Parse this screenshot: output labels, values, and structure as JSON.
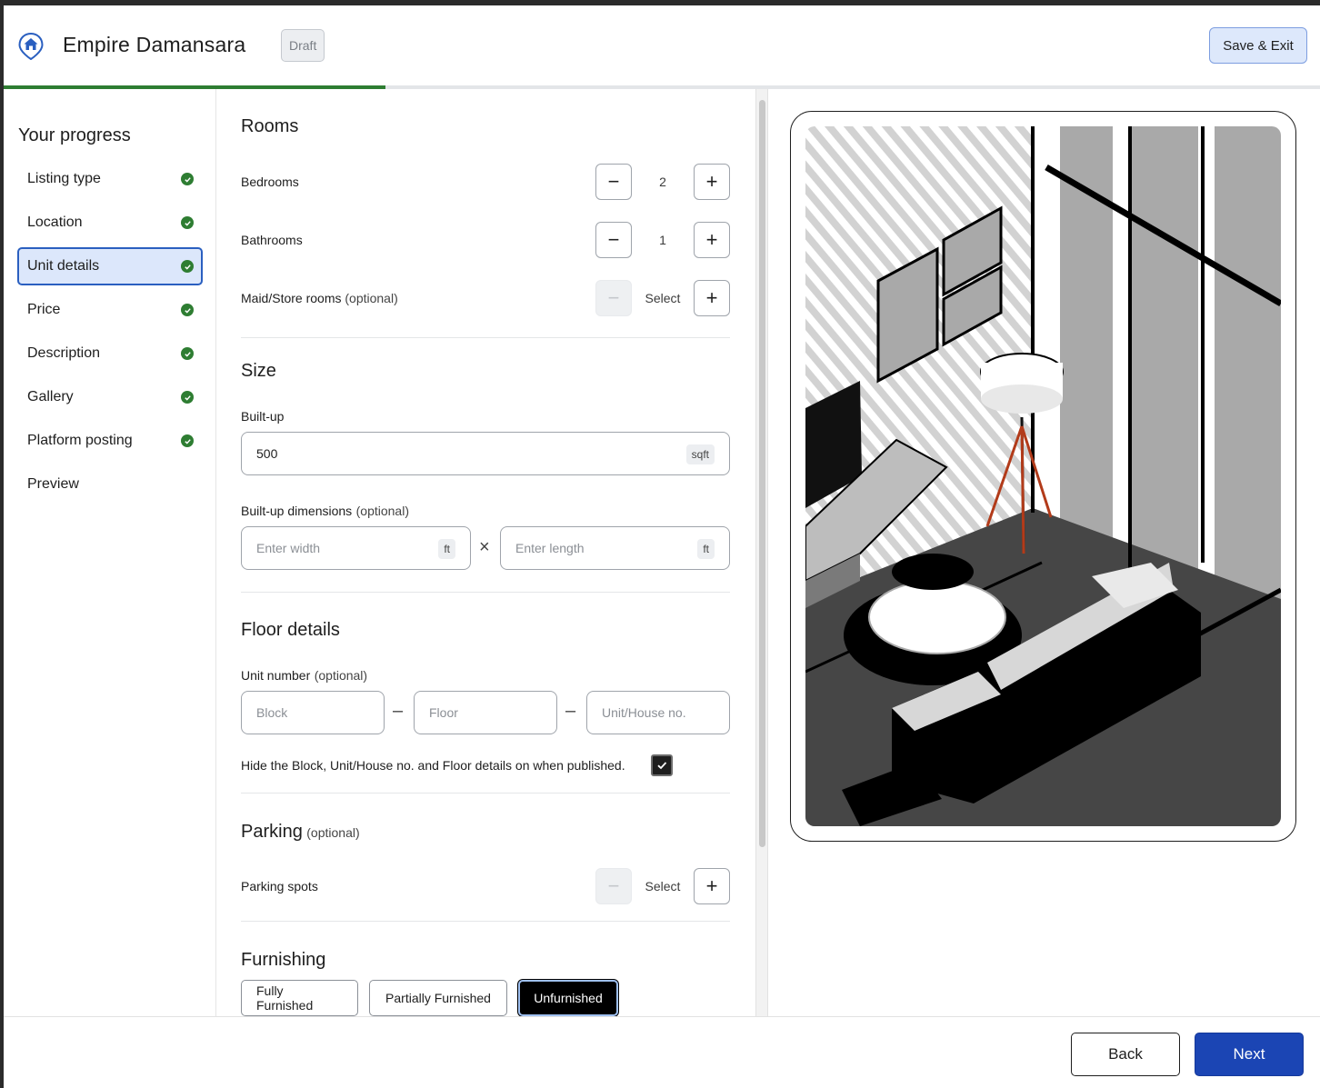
{
  "header": {
    "title": "Empire Damansara",
    "badge": "Draft",
    "save_exit_label": "Save & Exit",
    "progress_fraction": 0.29
  },
  "sidebar": {
    "heading": "Your progress",
    "items": [
      {
        "label": "Listing type",
        "complete": true,
        "active": false
      },
      {
        "label": "Location",
        "complete": true,
        "active": false
      },
      {
        "label": "Unit details",
        "complete": true,
        "active": true
      },
      {
        "label": "Price",
        "complete": true,
        "active": false
      },
      {
        "label": "Description",
        "complete": true,
        "active": false
      },
      {
        "label": "Gallery",
        "complete": true,
        "active": false
      },
      {
        "label": "Platform posting",
        "complete": true,
        "active": false
      },
      {
        "label": "Preview",
        "complete": false,
        "active": false
      }
    ]
  },
  "rooms": {
    "heading": "Rooms",
    "bedrooms": {
      "label": "Bedrooms",
      "value": "2"
    },
    "bathrooms": {
      "label": "Bathrooms",
      "value": "1"
    },
    "maid": {
      "label": "Maid/Store rooms",
      "optional": "(optional)",
      "value": "Select"
    }
  },
  "size": {
    "heading": "Size",
    "builtup_label": "Built-up",
    "builtup_value": "500",
    "builtup_unit": "sqft",
    "dims_label": "Built-up dimensions",
    "dims_optional": "(optional)",
    "width_placeholder": "Enter width",
    "length_placeholder": "Enter length",
    "dim_unit": "ft",
    "times": "×"
  },
  "floor": {
    "heading": "Floor details",
    "unit_label": "Unit number",
    "unit_optional": "(optional)",
    "block_placeholder": "Block",
    "floor_placeholder": "Floor",
    "unitno_placeholder": "Unit/House no.",
    "dash": "–",
    "hide_label": "Hide the Block, Unit/House no. and Floor details on when published.",
    "hide_checked": true
  },
  "parking": {
    "heading": "Parking",
    "optional": "(optional)",
    "spots_label": "Parking spots",
    "spots_value": "Select"
  },
  "furnishing": {
    "heading": "Furnishing",
    "options": [
      "Fully Furnished",
      "Partially Furnished",
      "Unfurnished"
    ],
    "selected": "Unfurnished"
  },
  "footer": {
    "back_label": "Back",
    "next_label": "Next"
  },
  "colors": {
    "accent_blue": "#1b45b4",
    "progress_green": "#2e7d32",
    "active_bg": "#dce7fb"
  },
  "icons": {
    "logo": "home-pin-icon",
    "check": "check-circle-icon",
    "minus": "minus-icon",
    "plus": "plus-icon"
  }
}
